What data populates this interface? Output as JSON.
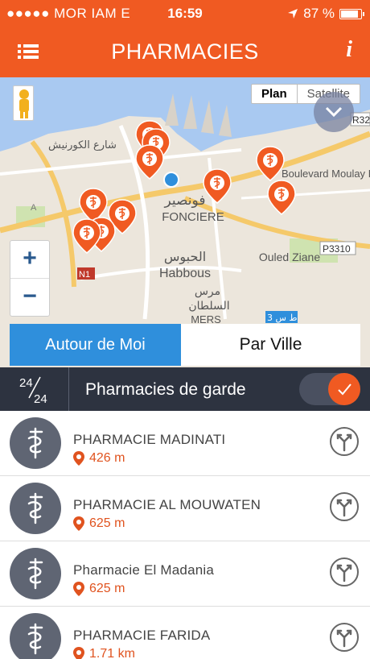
{
  "status_bar": {
    "carrier": "●●●●● MOR IAM   E",
    "time": "16:59",
    "battery": "87 %",
    "battery_level": 0.87
  },
  "nav": {
    "title": "PHARMACIES",
    "info_label": "i",
    "menu_icon": "list-menu-icon",
    "info_icon": "info-icon"
  },
  "map": {
    "toggle": {
      "plan": "Plan",
      "satellite": "Satellite"
    },
    "labels": {
      "foncier_ar": "فونصير",
      "foncier": "FONCIERE",
      "habbous_ar": "الحبوس",
      "habbous": "Habbous",
      "mers_ar1": "مرس",
      "mers_ar2": "السلطان",
      "mers": "MERS",
      "ouled_ziane": "Ouled Ziane",
      "boulevard": "Boulevard Moulay Ismaïl",
      "r32": "R32",
      "p3310": "P3310",
      "n1": "N1",
      "corniche_ar": "شارع الكورنيش",
      "road_a": "A",
      "road_3": "3 ط س"
    },
    "zoom_in": "+",
    "zoom_out": "−",
    "segments": {
      "near": "Autour de Moi",
      "city": "Par Ville"
    }
  },
  "garde": {
    "badge_top": "24",
    "badge_bottom": "24",
    "label": "Pharmacies de garde",
    "checkmark": "✓"
  },
  "pharmacies": [
    {
      "name": "PHARMACIE MADINATI",
      "distance": "426 m"
    },
    {
      "name": "PHARMACIE AL MOUWATEN",
      "distance": "625 m"
    },
    {
      "name": "Pharmacie El Madania",
      "distance": "625 m"
    },
    {
      "name": "PHARMACIE FARIDA",
      "distance": "1.71 km"
    }
  ],
  "colors": {
    "brand": "#f05a22",
    "dark": "#2d3340",
    "segment_active": "#2f8fdc",
    "avatar": "#5f6573"
  }
}
